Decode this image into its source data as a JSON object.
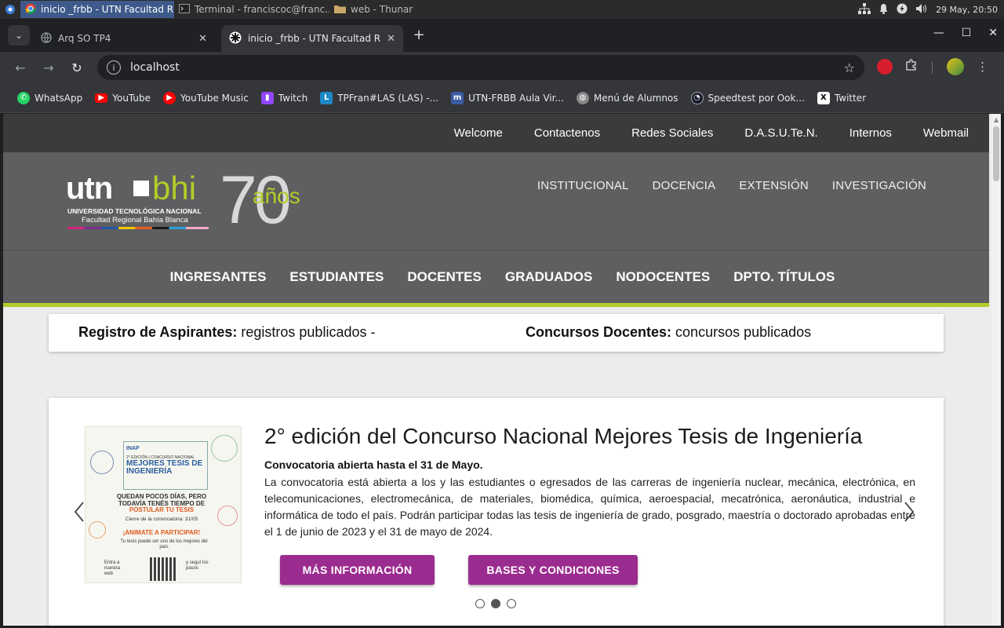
{
  "taskbar": {
    "tasks": [
      {
        "label": "inicio _frbb - UTN Facultad R...",
        "active": true
      },
      {
        "label": "Terminal - franciscoc@franc...",
        "active": false
      },
      {
        "label": "web - Thunar",
        "active": false
      }
    ],
    "clock": "29 May, 20:50"
  },
  "browser": {
    "tabs": [
      {
        "label": "Arq SO TP4",
        "active": false
      },
      {
        "label": "inicio _frbb - UTN Facultad Re",
        "active": true
      }
    ],
    "address": "localhost",
    "bookmarks": [
      {
        "label": "WhatsApp",
        "icon": "whatsapp-icon",
        "color": "#25d366"
      },
      {
        "label": "YouTube",
        "icon": "youtube-icon",
        "color": "#ff0000"
      },
      {
        "label": "YouTube Music",
        "icon": "youtube-music-icon",
        "color": "#ff0000"
      },
      {
        "label": "Twitch",
        "icon": "twitch-icon",
        "color": "#9146ff"
      },
      {
        "label": "TPFran#LAS (LAS) -...",
        "icon": "las-icon",
        "color": "#1e88c8"
      },
      {
        "label": "UTN-FRBB Aula Vir...",
        "icon": "moodle-icon",
        "color": "#3b5ba5"
      },
      {
        "label": "Menú de Alumnos",
        "icon": "globe-icon",
        "color": "#888888"
      },
      {
        "label": "Speedtest por Ook...",
        "icon": "speedtest-icon",
        "color": "#141526"
      },
      {
        "label": "Twitter",
        "icon": "x-icon",
        "color": "#000000"
      }
    ]
  },
  "site": {
    "topnav": [
      "Welcome",
      "Contactenos",
      "Redes Sociales",
      "D.A.S.U.Te.N.",
      "Internos",
      "Webmail"
    ],
    "logo": {
      "utn": "utn",
      "bhi": "bhi",
      "line1": "UNIVERSIDAD TECNOLÓGICA NACIONAL",
      "line2": "Facultad Regional Bahía Blanca",
      "seventy": "70",
      "anos": "años"
    },
    "header_menu": [
      "INSTITUCIONAL",
      "DOCENCIA",
      "EXTENSIÓN",
      "INVESTIGACIÓN"
    ],
    "main_menu": [
      "INGRESANTES",
      "ESTUDIANTES",
      "DOCENTES",
      "GRADUADOS",
      "NODOCENTES",
      "DPTO. TÍTULOS"
    ],
    "notice": {
      "left_bold": "Registro de Aspirantes:",
      "left_text": " registros publicados -",
      "right_bold": "Concursos Docentes:",
      "right_text": " concursos publicados"
    },
    "slide": {
      "title": "2° edición del Concurso Nacional Mejores Tesis de Ingeniería",
      "subtitle": "Convocatoria abierta hasta el 31 de Mayo.",
      "body": "La convocatoria está abierta a los y las estudiantes o egresados de las carreras de ingeniería nuclear, mecánica, electrónica, en telecomunicaciones, electromecánica, de materiales, biomédica, química, aeroespacial, mecatrónica, aeronáutica, industrial e informática de todo el país. Podrán participar todas las tesis de ingeniería de grado, posgrado, maestría o doctorado aprobadas entre el 1 de junio de 2023 y el 31 de mayo de 2024.",
      "button_more": "MÁS INFORMACIÓN",
      "button_bases": "BASES Y CONDICIONES",
      "active_dot": 1,
      "poster": {
        "brand": "INAP",
        "edition": "2° EDICIÓN | CONCURSO NACIONAL",
        "title": "MEJORES TESIS DE INGENIERÍA",
        "quedan": "QUEDAN POCOS DÍAS, PERO TODAVÍA TENÉS TIEMPO DE",
        "postular": "POSTULAR TU TESIS",
        "cierre": "Cierre de la convocatoria: 31/05",
        "animate": "¡ANIMATE A PARTICIPAR!",
        "tu_tesis": "Tu tesis puede ser uno de los mejores del país",
        "entra": "Entra a nuestra web",
        "segui": "y seguí los pasos"
      }
    }
  },
  "colors": {
    "accent_green": "#b5cc28",
    "button_purple": "#9b2c8f",
    "header_gray": "#5e5f61",
    "topnav_dark": "#3b3b3b"
  }
}
